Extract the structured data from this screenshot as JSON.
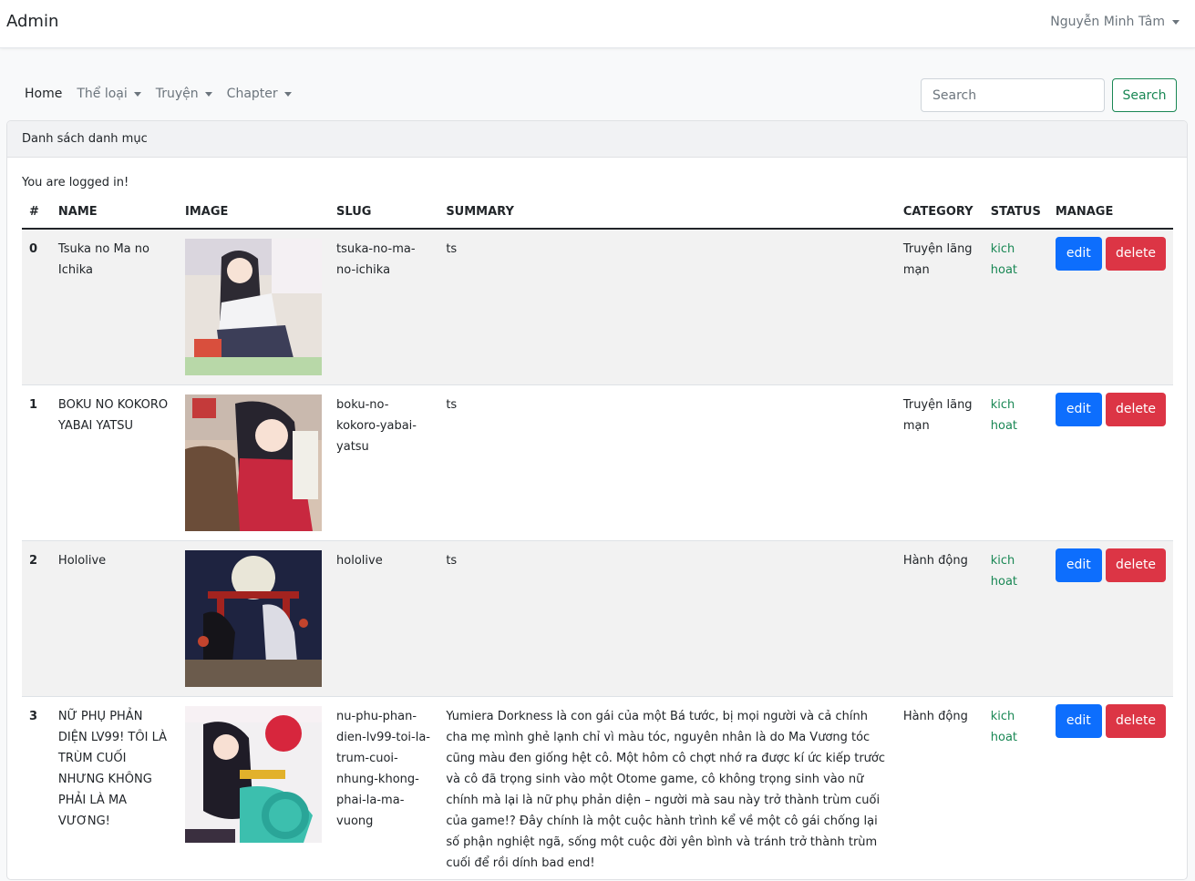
{
  "header": {
    "brand": "Admin",
    "user": "Nguyễn Minh Tâm"
  },
  "nav": {
    "home": "Home",
    "items": [
      "Thể loại",
      "Truyện",
      "Chapter"
    ]
  },
  "search": {
    "placeholder": "Search",
    "button": "Search"
  },
  "card": {
    "title": "Danh sách danh mục",
    "status_message": "You are logged in!"
  },
  "table": {
    "headers": [
      "#",
      "NAME",
      "IMAGE",
      "SLUG",
      "SUMMARY",
      "CATEGORY",
      "STATUS",
      "MANAGE"
    ],
    "rows": [
      {
        "idx": "0",
        "name": "Tsuka no Ma no Ichika",
        "slug": "tsuka-no-ma-no-ichika",
        "summary": "ts",
        "category": "Truyện lãng mạn",
        "status": "kich hoat"
      },
      {
        "idx": "1",
        "name": "BOKU NO KOKORO YABAI YATSU",
        "slug": "boku-no-kokoro-yabai-yatsu",
        "summary": "ts",
        "category": "Truyện lãng mạn",
        "status": "kich hoat"
      },
      {
        "idx": "2",
        "name": "Hololive",
        "slug": "hololive",
        "summary": "ts",
        "category": "Hành động",
        "status": "kich hoat"
      },
      {
        "idx": "3",
        "name": "NỮ PHỤ PHẢN DIỆN LV99! TÔI LÀ TRÙM CUỐI NHƯNG KHÔNG PHẢI LÀ MA VƯƠNG!",
        "slug": "nu-phu-phan-dien-lv99-toi-la-trum-cuoi-nhung-khong-phai-la-ma-vuong",
        "summary": "Yumiera Dorkness là con gái của một Bá tước, bị mọi người và cả chính cha mẹ mình ghẻ lạnh chỉ vì màu tóc, nguyên nhân là do Ma Vương tóc cũng màu đen giống hệt cô. Một hôm cô chợt nhớ ra được kí ức kiếp trước và cô đã trọng sinh vào một Otome game, cô không trọng sinh vào nữ chính mà lại là nữ phụ phản diện – người mà sau này trở thành trùm cuối của game!? Đây chính là một cuộc hành trình kể về một cô gái chống lại số phận nghiệt ngã, sống một cuộc đời yên bình và tránh trở thành trùm cuối để rồi dính bad end!",
        "category": "Hành động",
        "status": "kich hoat"
      }
    ],
    "edit_label": "edit",
    "delete_label": "delete"
  }
}
